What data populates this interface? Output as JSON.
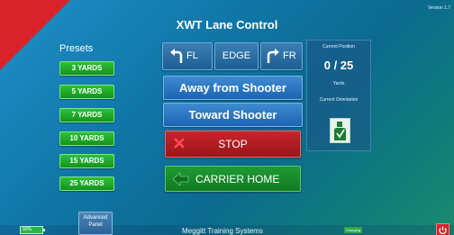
{
  "app": {
    "title": "XWT Lane Control",
    "version": "Version 1.7"
  },
  "presets": {
    "label": "Presets",
    "items": [
      "3 YARDS",
      "5 YARDS",
      "7 YARDS",
      "10 YARDS",
      "15 YARDS",
      "25 YARDS"
    ]
  },
  "turning": {
    "fl": "FL",
    "edge": "EDGE",
    "fr": "FR"
  },
  "movement": {
    "away": "Away from Shooter",
    "toward": "Toward Shooter"
  },
  "controls": {
    "stop": "STOP",
    "carrier_home": "CARRIER HOME"
  },
  "status": {
    "current_position_label": "Current Position",
    "current_position_value": "0 / 25",
    "yards_label": "Yards",
    "current_orientation_label": "Current Orientation"
  },
  "footer": {
    "battery": "90%",
    "advanced_panel": "Advanced Panel",
    "company": "Meggitt Training Systems",
    "charging": "Charging"
  },
  "colors": {
    "preset_green": "#1ea52a",
    "stop_red": "#b81c22",
    "home_green": "#178a29",
    "move_blue": "#2a74c2",
    "corner_red": "#d9232a"
  },
  "icons": {
    "fl": "turn-left-arrow-icon",
    "fr": "turn-right-arrow-icon",
    "stop": "x-icon",
    "home": "home-arrow-icon",
    "orientation": "target-silhouette-icon",
    "power": "power-icon"
  }
}
